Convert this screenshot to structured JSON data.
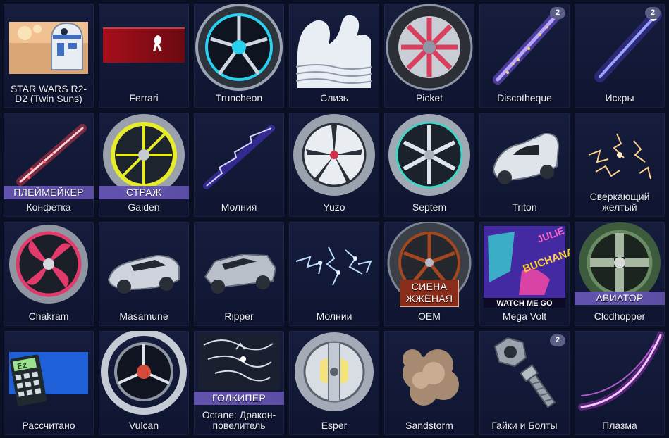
{
  "items": [
    {
      "name": "STAR WARS R2-D2 (Twin Suns)",
      "icon": "r2d2-decal-icon"
    },
    {
      "name": "Ferrari",
      "icon": "ferrari-decal-icon"
    },
    {
      "name": "Truncheon",
      "icon": "wheel-icon"
    },
    {
      "name": "Слизь",
      "icon": "slime-icon"
    },
    {
      "name": "Picket",
      "icon": "wheel-icon"
    },
    {
      "name": "Discotheque",
      "icon": "boost-trail-icon",
      "count": "2"
    },
    {
      "name": "Искры",
      "icon": "boost-trail-icon",
      "count": "2"
    },
    {
      "name": "Конфетка",
      "icon": "boost-trail-icon",
      "label": "ПЛЕЙМЕЙКЕР"
    },
    {
      "name": "Gaiden",
      "icon": "wheel-icon",
      "label": "СТРАЖ"
    },
    {
      "name": "Молния",
      "icon": "lightning-trail-icon"
    },
    {
      "name": "Yuzo",
      "icon": "wheel-icon"
    },
    {
      "name": "Septem",
      "icon": "wheel-icon"
    },
    {
      "name": "Triton",
      "icon": "car-body-icon"
    },
    {
      "name": "Сверкающий желтый",
      "icon": "sparkle-icon"
    },
    {
      "name": "Chakram",
      "icon": "wheel-icon"
    },
    {
      "name": "Masamune",
      "icon": "car-body-icon"
    },
    {
      "name": "Ripper",
      "icon": "car-body-icon"
    },
    {
      "name": "Молнии",
      "icon": "lightning-icon"
    },
    {
      "name": "OEM",
      "icon": "wheel-icon",
      "label": "СИЕНА ЖЖЁНАЯ"
    },
    {
      "name": "Mega Volt",
      "icon": "player-banner-icon",
      "art_text": [
        "JULIE",
        "BUCHANAN",
        "WATCH ME GO"
      ]
    },
    {
      "name": "Clodhopper",
      "icon": "wheel-icon",
      "label": "АВИАТОР"
    },
    {
      "name": "Рассчитано",
      "icon": "calculator-decal-icon",
      "art_text": "Ez"
    },
    {
      "name": "Vulcan",
      "icon": "wheel-icon"
    },
    {
      "name": "Octane: Дракон-повелитель",
      "icon": "dragon-decal-icon",
      "label": "ГОЛКИПЕР"
    },
    {
      "name": "Esper",
      "icon": "wheel-icon"
    },
    {
      "name": "Sandstorm",
      "icon": "smoke-goal-explosion-icon"
    },
    {
      "name": "Гайки и Болты",
      "icon": "nuts-bolts-icon",
      "count": "2"
    },
    {
      "name": "Плазма",
      "icon": "plasma-trail-icon"
    }
  ],
  "colors": {
    "background": "#0a0f24",
    "tile": "#141a38",
    "badge": "#5b5f86",
    "label_band": "#6656b4",
    "label_band_alt": "#8a2c1a"
  }
}
